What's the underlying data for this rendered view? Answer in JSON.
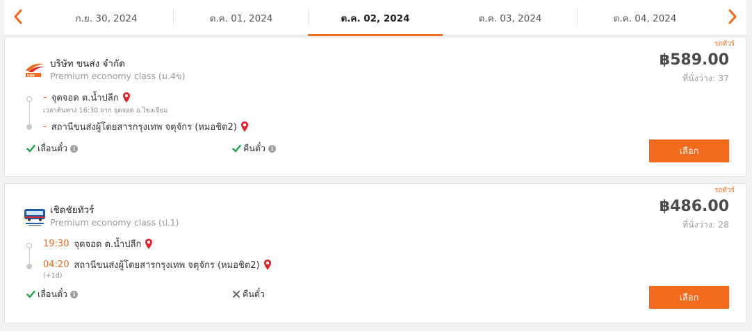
{
  "colors": {
    "accent": "#f26b1d",
    "check": "#1aa34a",
    "pin": "#e0262d"
  },
  "datebar": {
    "prev_icon": "chevron-left-icon",
    "next_icon": "chevron-right-icon",
    "dates": [
      "ก.ย. 30, 2024",
      "ต.ค. 01, 2024",
      "ต.ค. 02, 2024",
      "ต.ค. 03, 2024",
      "ต.ค. 04, 2024"
    ],
    "active_index": 2
  },
  "trips": [
    {
      "tag": "รถทัวร์",
      "logo_icon": "bus-company-logo",
      "operator": "บริษัท ขนส่ง จำกัด",
      "class": "Premium economy class (ม.4ข)",
      "price": "฿589.00",
      "seats": "ที่นั่งว่าง: 37",
      "departure": {
        "time": "-",
        "place": "จุดจอด ต.น้ำปลีก",
        "note": "เวลาต้นทาง 16:30   จาก จุดจอด อ.ไขงเจียม"
      },
      "arrival": {
        "time": "-",
        "place": "สถานีขนส่งผู้โดยสารกรุงเทพ จตุจักร (หมอชิต2)",
        "note": ""
      },
      "reschedule": {
        "label": "เลื่อนตั๋ว",
        "allowed": true
      },
      "refund": {
        "label": "คืนตั๋ว",
        "allowed": true
      },
      "button": "เลือก"
    },
    {
      "tag": "รถทัวร์",
      "logo_icon": "bus-company-logo",
      "operator": "เชิดชัยทัวร์",
      "class": "Premium economy class (ป.1)",
      "price": "฿486.00",
      "seats": "ที่นั่งว่าง: 28",
      "departure": {
        "time": "19:30",
        "place": "จุดจอด ต.น้ำปลีก",
        "note": ""
      },
      "arrival": {
        "time": "04:20",
        "place": "สถานีขนส่งผู้โดยสารกรุงเทพ จตุจักร (หมอชิต2)",
        "note": "(+1d)"
      },
      "reschedule": {
        "label": "เลื่อนตั๋ว",
        "allowed": true
      },
      "refund": {
        "label": "คืนตั๋ว",
        "allowed": false
      },
      "button": "เลือก"
    }
  ]
}
